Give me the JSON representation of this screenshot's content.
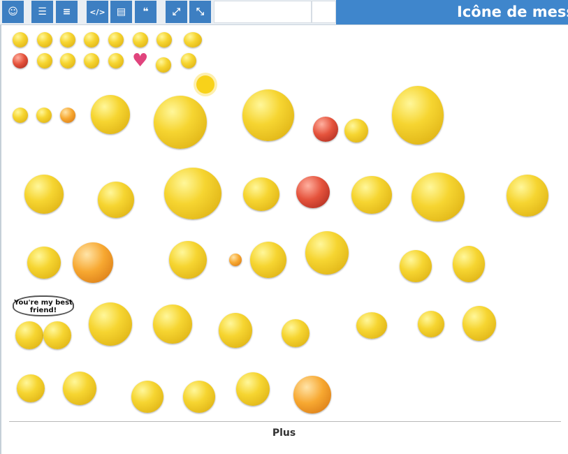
{
  "toolbar": {
    "buttons": [
      {
        "icon": "smiley-icon",
        "glyph": "☺"
      },
      {
        "icon": "bulleted-list-icon",
        "glyph": "☰"
      },
      {
        "icon": "numbered-list-icon",
        "glyph": "≡"
      },
      {
        "icon": "code-icon",
        "glyph": "</>"
      },
      {
        "icon": "document-icon",
        "glyph": "▤"
      },
      {
        "icon": "quote-icon",
        "glyph": "❝"
      },
      {
        "icon": "expand-icon",
        "glyph": "⤢"
      },
      {
        "icon": "collapse-icon",
        "glyph": "⤡"
      }
    ]
  },
  "header": {
    "title": "Icône de messa"
  },
  "smileys_panel": {
    "more_label": "Plus",
    "heart_glyph": "♥",
    "bubble_text": "You're my best friend!",
    "accent_color": "#3f86cc",
    "button_color": "#3d7fc2"
  }
}
